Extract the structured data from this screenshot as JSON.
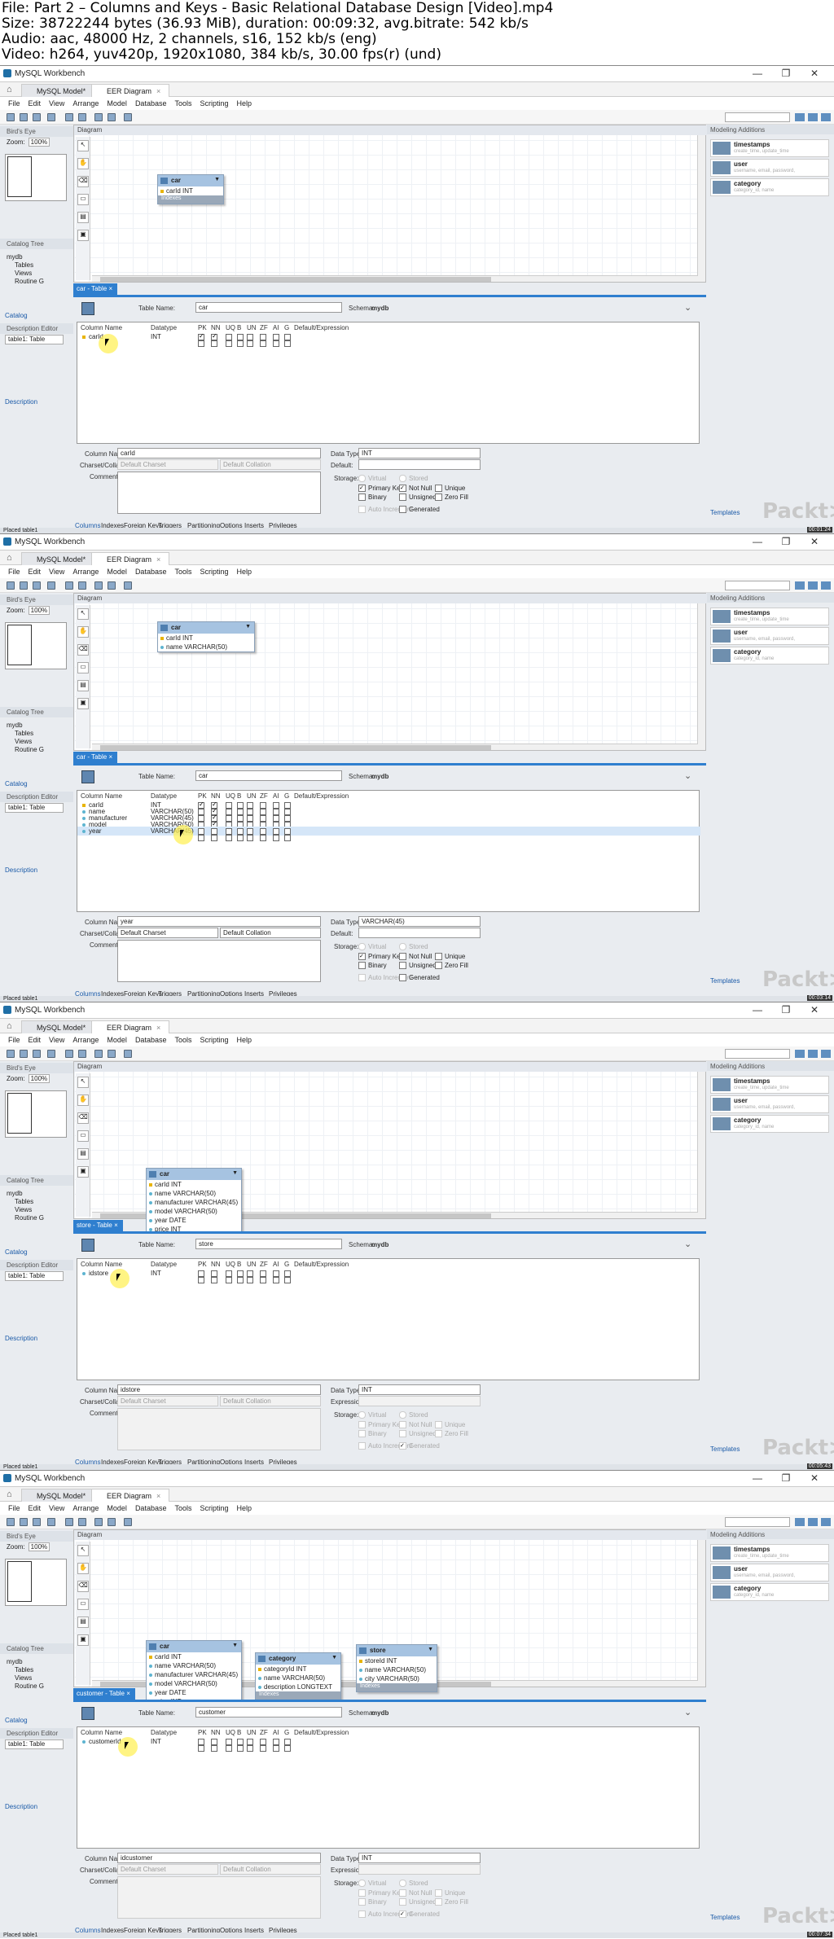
{
  "header": {
    "lines": [
      "File: Part 2 – Columns and Keys - Basic Relational Database Design [Video].mp4",
      "Size: 38722244 bytes (36.93 MiB), duration: 00:09:32, avg.bitrate: 542 kb/s",
      "Audio: aac, 48000 Hz, 2 channels, s16, 152 kb/s (eng)",
      "Video: h264, yuv420p, 1920x1080, 384 kb/s, 30.00 fps(r) (und)"
    ]
  },
  "common": {
    "app_title": "MySQL Workbench",
    "tab_model": "MySQL Model*",
    "tab_eer": "EER Diagram",
    "menu": [
      "File",
      "Edit",
      "View",
      "Arrange",
      "Model",
      "Database",
      "Tools",
      "Scripting",
      "Help"
    ],
    "birds_eye": "Bird's Eye",
    "zoom_label": "Zoom:",
    "zoom_value": "100%",
    "catalog_tree": "Catalog Tree",
    "tree": [
      "mydb",
      "Tables",
      "Views",
      "Routine G"
    ],
    "catalog_tab": "Catalog",
    "desc_editor": "Description Editor",
    "table_select": "table1: Table",
    "description_tab": "Description",
    "diagram": "Diagram",
    "modeling_additions": "Modeling Additions",
    "snippets": [
      {
        "name": "timestamps",
        "desc": "create_time, update_time"
      },
      {
        "name": "user",
        "desc": "username, email, password,"
      },
      {
        "name": "category",
        "desc": "category_id, name"
      }
    ],
    "templates": "Templates",
    "packt": "Packt>",
    "table_name_label": "Table Name:",
    "schema_label": "Schema:",
    "schema_value": "mydb",
    "grid_headers": [
      "Column Name",
      "Datatype",
      "PK",
      "NN",
      "UQ",
      "B",
      "UN",
      "ZF",
      "AI",
      "G",
      "Default/Expression"
    ],
    "column_name_label": "Column Name:",
    "charset_label": "Charset/Collation:",
    "comments_label": "Comments:",
    "data_type_label": "Data Type:",
    "default_label": "Default:",
    "expression_label": "Expression:",
    "storage_label": "Storage:",
    "default_charset": "Default Charset",
    "default_collation": "Default Collation",
    "storage": [
      "Virtual",
      "Stored",
      "Primary Key",
      "Not Null",
      "Unique",
      "Binary",
      "Unsigned",
      "Zero Fill",
      "Auto Increment",
      "Generated"
    ],
    "bottom_tabs": [
      "Columns",
      "Indexes",
      "Foreign Keys",
      "Triggers",
      "Partitioning",
      "Options",
      "Inserts",
      "Privileges"
    ],
    "status": "Placed table1",
    "indexes": "Indexes"
  },
  "panels": [
    {
      "editor_tab": "car - Table",
      "table_name": "car",
      "col_name": "carId",
      "data_type": "INT",
      "default_or_expr": "Default:",
      "stamp": "00:01:24",
      "rows": [
        {
          "name": "carId",
          "type": "INT",
          "pk": true,
          "nn": true
        }
      ],
      "entities": [
        {
          "name": "car",
          "cols": [
            "carId INT"
          ],
          "pk": [
            0
          ],
          "footer": "Indexes"
        }
      ]
    },
    {
      "editor_tab": "car - Table",
      "table_name": "car",
      "col_name": "year",
      "data_type": "VARCHAR(45)",
      "default_or_expr": "Default:",
      "stamp": "00:03:14",
      "rows": [
        {
          "name": "carId",
          "type": "INT",
          "pk": true,
          "nn": true
        },
        {
          "name": "name",
          "type": "VARCHAR(50)",
          "pk": false,
          "nn": true
        },
        {
          "name": "manufacturer",
          "type": "VARCHAR(45)",
          "pk": false,
          "nn": true
        },
        {
          "name": "model",
          "type": "VARCHAR(50)",
          "pk": false,
          "nn": true
        },
        {
          "name": "year",
          "type": "VARCHAR(45)",
          "pk": false,
          "nn": false
        }
      ],
      "entities": [
        {
          "name": "car",
          "cols": [
            "carId INT",
            "name VARCHAR(50)"
          ],
          "pk": [
            0
          ],
          "footer": ""
        }
      ]
    },
    {
      "editor_tab": "store - Table",
      "table_name": "store",
      "col_name": "idstore",
      "data_type": "INT",
      "default_or_expr": "Expression:",
      "stamp": "00:05:43",
      "rows": [
        {
          "name": "idstore",
          "type": "INT",
          "pk": false,
          "nn": false
        }
      ],
      "entities": [
        {
          "name": "car",
          "cols": [
            "carId INT",
            "name VARCHAR(50)",
            "manufacturer VARCHAR(45)",
            "model VARCHAR(50)",
            "year DATE",
            "price INT"
          ],
          "pk": [
            0
          ],
          "footer": ""
        }
      ]
    },
    {
      "editor_tab": "customer - Table",
      "table_name": "customer",
      "col_name": "idcustomer",
      "data_type": "INT",
      "default_or_expr": "Expression:",
      "stamp": "00:07:34",
      "rows": [
        {
          "name": "customerId",
          "type": "INT",
          "pk": false,
          "nn": false
        }
      ],
      "entities": [
        {
          "name": "car",
          "cols": [
            "carId INT",
            "name VARCHAR(50)",
            "manufacturer VARCHAR(45)",
            "model VARCHAR(50)",
            "year DATE",
            "price INT"
          ],
          "pk": [
            0
          ],
          "footer": ""
        },
        {
          "name": "category",
          "cols": [
            "categoryId INT",
            "name VARCHAR(50)",
            "description LONGTEXT"
          ],
          "pk": [
            0
          ],
          "footer": "Indexes"
        },
        {
          "name": "store",
          "cols": [
            "storeId INT",
            "name VARCHAR(50)",
            "city VARCHAR(50)"
          ],
          "pk": [
            0
          ],
          "footer": "Indexes"
        }
      ]
    }
  ]
}
